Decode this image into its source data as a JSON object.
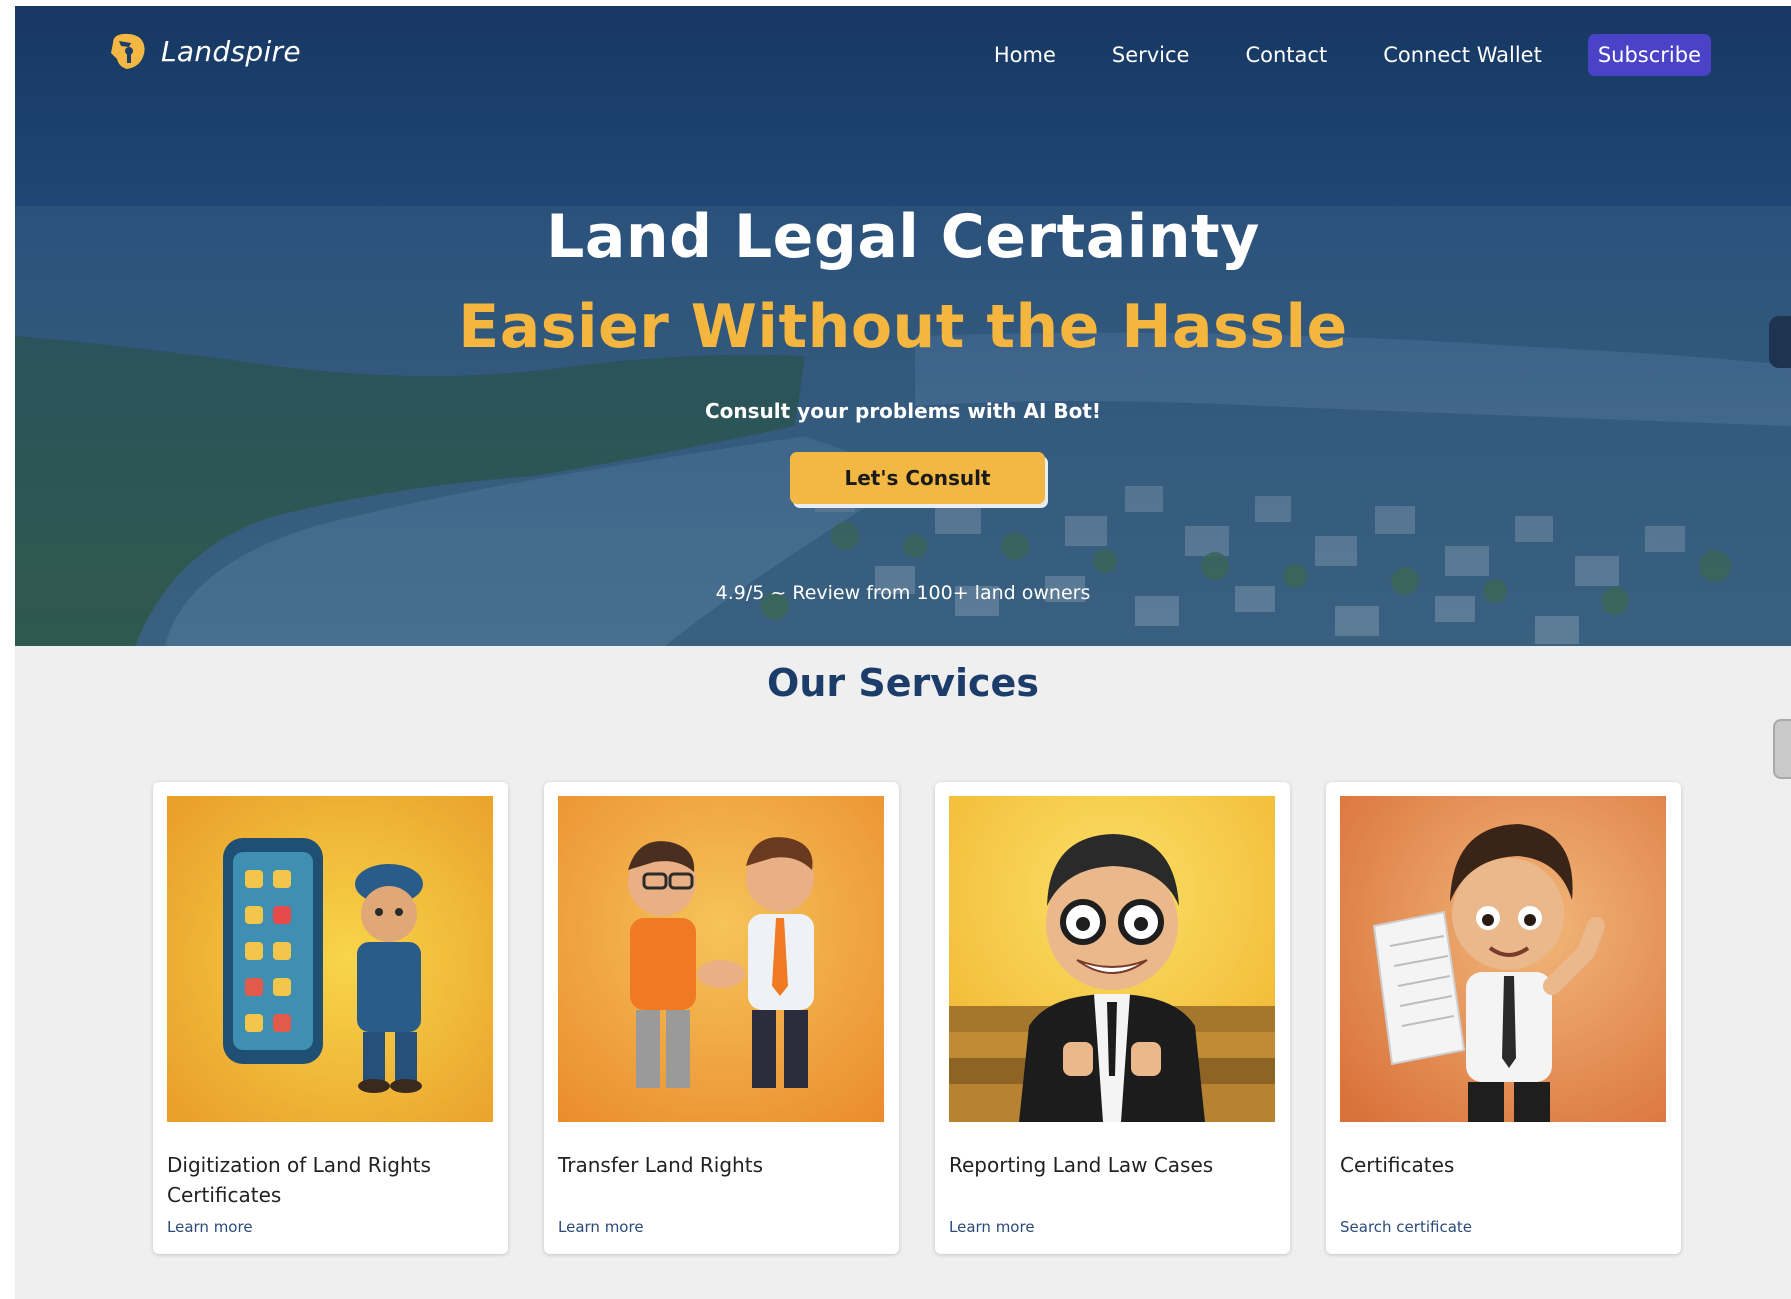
{
  "brand": {
    "name": "Landspire",
    "logo_icon": "key-shield-icon",
    "accent": "#f2b843"
  },
  "nav": {
    "links": [
      "Home",
      "Service",
      "Contact",
      "Connect Wallet"
    ],
    "subscribe_label": "Subscribe",
    "subscribe_color": "#4a43c8"
  },
  "hero": {
    "title": "Land Legal Certainty",
    "subtitle": "Easier Without the Hassle",
    "tagline": "Consult your problems with AI Bot!",
    "cta_label": "Let's Consult",
    "rating_text": "4.9/5 ~ Review from 100+ land owners",
    "background_image": "aerial-city-river-photo"
  },
  "services": {
    "title": "Our Services",
    "cards": [
      {
        "title": "Digitization of Land Rights Certificates",
        "link": "Learn more",
        "image": "police-phone-illustration"
      },
      {
        "title": "Transfer Land Rights",
        "link": "Learn more",
        "image": "handshake-illustration"
      },
      {
        "title": "Reporting Land Law Cases",
        "link": "Learn more",
        "image": "lawyer-thumbs-up-illustration"
      },
      {
        "title": "Certificates",
        "link": "Search certificate",
        "image": "man-with-document-illustration"
      }
    ]
  }
}
